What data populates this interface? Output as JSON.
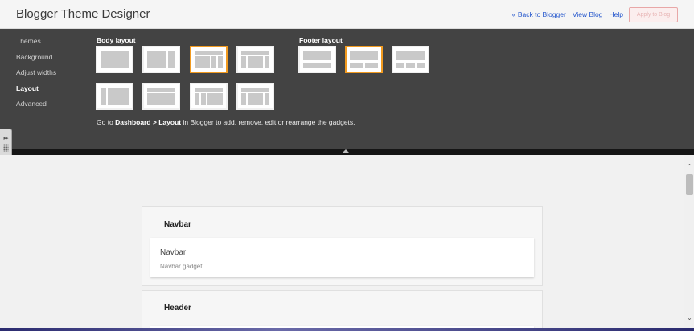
{
  "app": {
    "title": "Blogger Theme Designer",
    "links": [
      "« Back to Blogger",
      "View Blog",
      "Help"
    ],
    "apply_button": "Apply to Blog"
  },
  "sidenav": {
    "items": [
      {
        "label": "Themes",
        "active": false
      },
      {
        "label": "Background",
        "active": false
      },
      {
        "label": "Adjust widths",
        "active": false
      },
      {
        "label": "Layout",
        "active": true
      },
      {
        "label": "Advanced",
        "active": false
      }
    ]
  },
  "layout": {
    "body_label": "Body layout",
    "footer_label": "Footer layout",
    "selected_body_layout": 3,
    "selected_footer_layout": 2,
    "help_prefix": "Go to ",
    "help_bold": "Dashboard > Layout",
    "help_suffix": " in Blogger to add, remove, edit or rearrange the gadgets."
  },
  "preview": {
    "sections": [
      {
        "title": "Navbar",
        "gadget_title": "Navbar",
        "gadget_subtitle": "Navbar gadget"
      },
      {
        "title": "Header"
      }
    ]
  },
  "colors": {
    "panel": "#434343",
    "selected_border": "#f29b20",
    "link": "#2255cc",
    "apply_button_border": "#e8a7a7"
  }
}
